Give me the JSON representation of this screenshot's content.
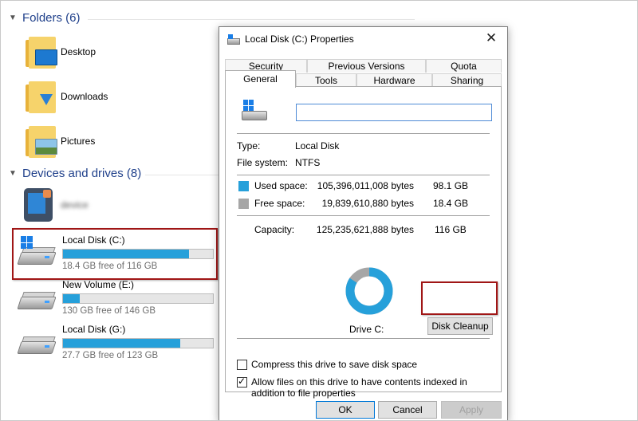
{
  "explorer": {
    "folders_header": "Folders (6)",
    "folders": [
      {
        "name": "Desktop"
      },
      {
        "name": "Downloads"
      },
      {
        "name": "Pictures"
      }
    ],
    "devices_header": "Devices and drives (8)",
    "phone": {
      "name": "device"
    },
    "drives": [
      {
        "name": "Local Disk (C:)",
        "free": "18.4 GB free of 116 GB",
        "used_fraction": 0.84
      },
      {
        "name": "New Volume (E:)",
        "free": "130 GB free of 146 GB",
        "used_fraction": 0.11
      },
      {
        "name": "Local Disk (G:)",
        "free": "27.7 GB free of 123 GB",
        "used_fraction": 0.78
      }
    ]
  },
  "dialog": {
    "title": "Local Disk (C:) Properties",
    "close_glyph": "✕",
    "tabs_row1": [
      "Security",
      "Previous Versions",
      "Quota"
    ],
    "tabs_row2": [
      "General",
      "Tools",
      "Hardware",
      "Sharing"
    ],
    "active_tab": "General",
    "name_value": "",
    "type_label": "Type:",
    "type_value": "Local Disk",
    "fs_label": "File system:",
    "fs_value": "NTFS",
    "used_label": "Used space:",
    "used_bytes": "105,396,011,008 bytes",
    "used_size": "98.1 GB",
    "free_label": "Free space:",
    "free_bytes": "19,839,610,880 bytes",
    "free_size": "18.4 GB",
    "capacity_label": "Capacity:",
    "capacity_bytes": "125,235,621,888 bytes",
    "capacity_size": "116 GB",
    "used_fraction": 0.842,
    "drive_label": "Drive C:",
    "cleanup_button": "Disk Cleanup",
    "compress_label": "Compress this drive to save disk space",
    "compress_checked": false,
    "index_label": "Allow files on this drive to have contents indexed in addition to file properties",
    "index_checked": true,
    "ok_button": "OK",
    "cancel_button": "Cancel",
    "apply_button": "Apply"
  },
  "colors": {
    "used": "#26a0da",
    "free": "#a6a6a6",
    "highlight": "#a01616",
    "section_header": "#1e3f8a"
  },
  "icons": {
    "folder": "folder-icon",
    "drive": "drive-icon",
    "phone": "phone-icon",
    "windows": "windows-logo-icon"
  }
}
